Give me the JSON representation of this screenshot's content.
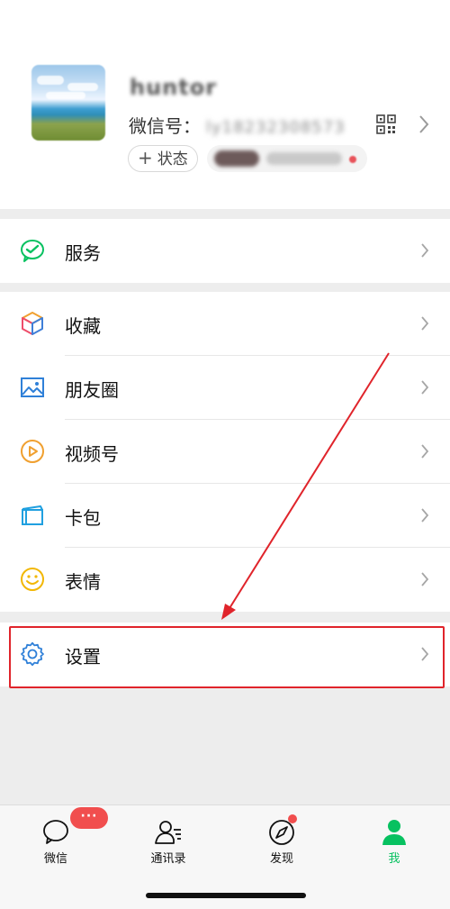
{
  "profile": {
    "nickname": "huntor",
    "wechat_id_label": "微信号：",
    "wechat_id_value": "ly18232308573",
    "status_button": "状态"
  },
  "menu": {
    "service": "服务",
    "favorites": "收藏",
    "moments": "朋友圈",
    "channels": "视频号",
    "cards": "卡包",
    "stickers": "表情",
    "settings": "设置"
  },
  "tabs": [
    {
      "label": "微信",
      "badge": "···",
      "icon": "chat-icon"
    },
    {
      "label": "通讯录",
      "icon": "contacts-icon"
    },
    {
      "label": "发现",
      "icon": "compass-icon"
    },
    {
      "label": "我",
      "icon": "person-icon"
    }
  ],
  "colors": {
    "accent": "#07c160",
    "badge": "#f14e4e",
    "highlight": "#e0242b"
  }
}
